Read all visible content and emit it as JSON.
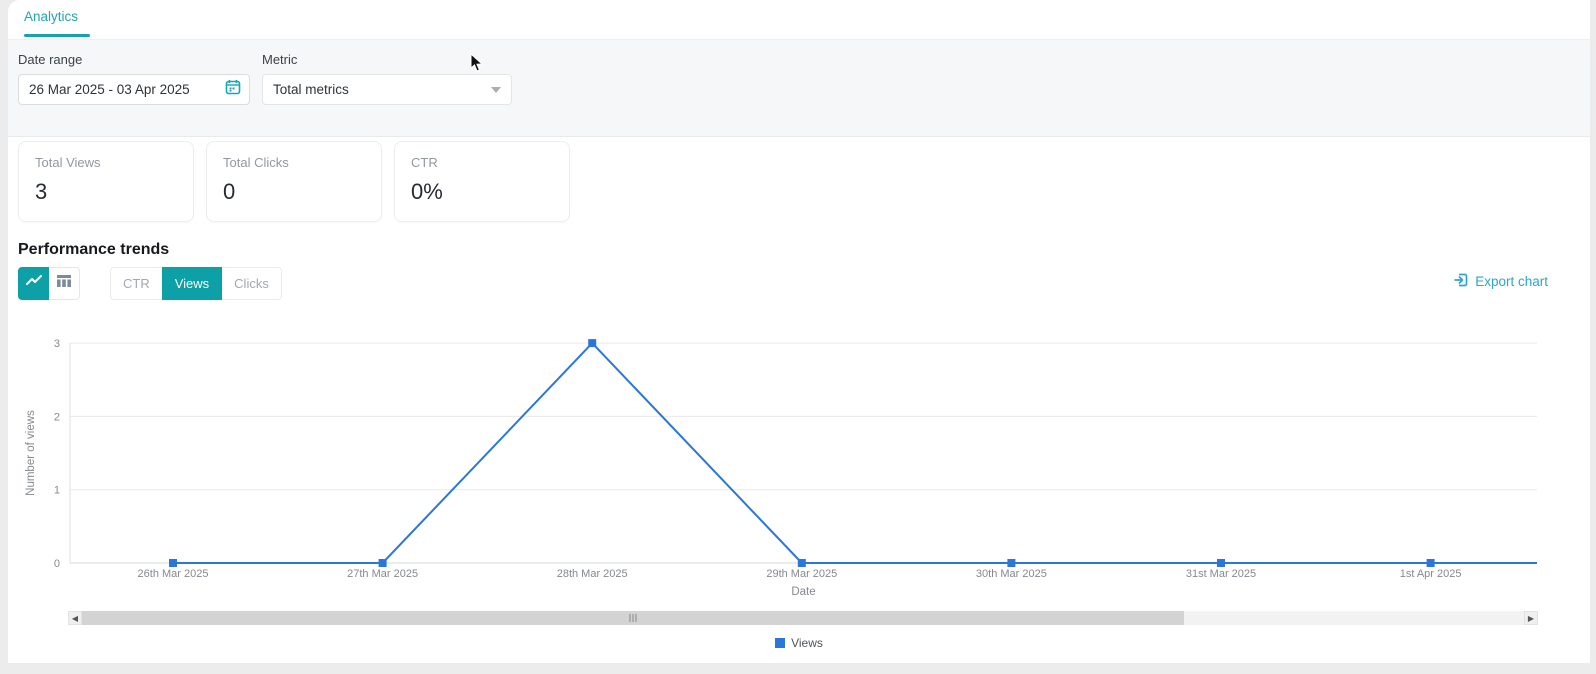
{
  "tabs": {
    "analytics_label": "Analytics"
  },
  "filters": {
    "date_range": {
      "label": "Date range",
      "value": "26 Mar 2025 - 03 Apr 2025"
    },
    "metric": {
      "label": "Metric",
      "value": "Total metrics"
    }
  },
  "stats": [
    {
      "label": "Total Views",
      "value": "3"
    },
    {
      "label": "Total Clicks",
      "value": "0"
    },
    {
      "label": "CTR",
      "value": "0%"
    }
  ],
  "performance": {
    "title": "Performance trends",
    "chart_type_buttons": [
      "line-chart",
      "table"
    ],
    "metric_tabs": [
      {
        "label": "CTR",
        "active": false
      },
      {
        "label": "Views",
        "active": true
      },
      {
        "label": "Clicks",
        "active": false
      }
    ],
    "export_label": "Export chart"
  },
  "chart_data": {
    "type": "line",
    "categories": [
      "26th Mar 2025",
      "27th Mar 2025",
      "28th Mar 2025",
      "29th Mar 2025",
      "30th Mar 2025",
      "31st Mar 2025",
      "1st Apr 2025"
    ],
    "series": [
      {
        "name": "Views",
        "values": [
          0,
          0,
          3,
          0,
          0,
          0,
          0
        ]
      }
    ],
    "title": "",
    "xlabel": "Date",
    "ylabel": "Number of views",
    "ylim": [
      0,
      3
    ],
    "yticks": [
      0,
      1,
      2,
      3
    ],
    "grid": true,
    "legend": [
      "Views"
    ],
    "legend_position": "bottom",
    "line_color": "#2b77d9",
    "marker": "square",
    "scrollable_x": true
  },
  "colors": {
    "brand_teal": "#0da1a7",
    "tab_teal": "#1fa6b2",
    "export_blue": "#2ba6cc",
    "chart_line_blue": "#2b77d9",
    "filter_bg": "#f5f7f8",
    "page_bg": "#ececec",
    "axis_text": "#85898e"
  }
}
